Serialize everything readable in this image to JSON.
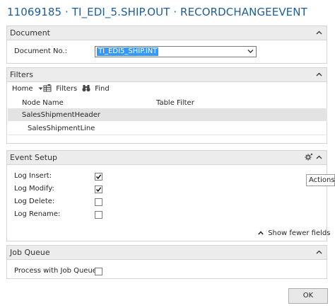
{
  "window": {
    "title": "11069185 · TI_EDI_5.SHIP.OUT · RECORDCHANGEEVENT"
  },
  "document": {
    "header": "Document",
    "doc_no_label": "Document No.:",
    "doc_no_value": "TI_EDI5_SHIP.INT"
  },
  "filters": {
    "header": "Filters",
    "toolbar": {
      "home": "Home",
      "filters": "Filters",
      "find": "Find"
    },
    "columns": {
      "node_name": "Node Name",
      "table_filter": "Table Filter"
    },
    "rows": [
      {
        "node": "SalesShipmentHeader",
        "filter": "",
        "selected": true
      },
      {
        "node": "SalesShipmentLine",
        "filter": "",
        "selected": false
      }
    ]
  },
  "event_setup": {
    "header": "Event Setup",
    "fields": [
      {
        "label": "Log Insert:",
        "checked": true
      },
      {
        "label": "Log Modify:",
        "checked": true
      },
      {
        "label": "Log Delete:",
        "checked": false
      },
      {
        "label": "Log Rename:",
        "checked": false
      }
    ],
    "show_fewer": "Show fewer fields",
    "tooltip": "Actions (Ctrl+Shift+A)"
  },
  "job_queue": {
    "header": "Job Queue",
    "process_label": "Process with Job Queue:",
    "process_checked": false
  },
  "footer": {
    "ok_label": "OK"
  },
  "colors": {
    "title": "#1f5d99",
    "section_header_bg": "#ececec",
    "selection": "#3399ff",
    "selected_row": "#e3e3e3"
  }
}
